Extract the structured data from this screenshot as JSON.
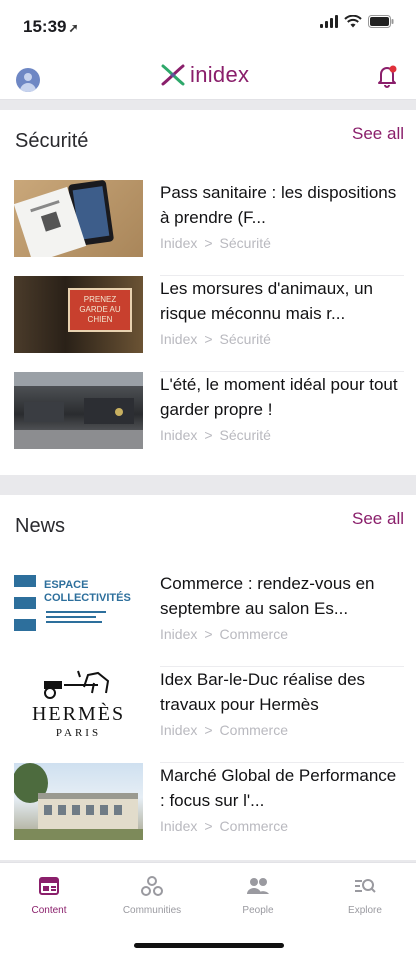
{
  "status_bar": {
    "time": "15:39"
  },
  "header": {
    "brand": "inidex"
  },
  "sections": [
    {
      "title": "Sécurité",
      "see_all": "See all",
      "items": [
        {
          "title": "Pass sanitaire : les dispositions à prendre (F...",
          "source": "Inidex",
          "sep": ">",
          "category": "Sécurité",
          "thumb_text": ""
        },
        {
          "title": "Les morsures d'animaux, un risque méconnu mais r...",
          "source": "Inidex",
          "sep": ">",
          "category": "Sécurité",
          "thumb_text": "PRENEZ GARDE AU CHIEN"
        },
        {
          "title": "L'été, le moment idéal pour tout garder propre !",
          "source": "Inidex",
          "sep": ">",
          "category": "Sécurité",
          "thumb_text": ""
        }
      ]
    },
    {
      "title": "News",
      "see_all": "See all",
      "items": [
        {
          "title": "Commerce : rendez-vous en septembre au salon Es...",
          "source": "Inidex",
          "sep": ">",
          "category": "Commerce",
          "thumb_text": "ESPACE COLLECTIVITÉS"
        },
        {
          "title": "Idex Bar-le-Duc réalise des travaux pour Hermès",
          "source": "Inidex",
          "sep": ">",
          "category": "Commerce",
          "thumb_text": "HERMÈS",
          "thumb_subtext": "PARIS"
        },
        {
          "title": "Marché Global de Performance : focus sur l'...",
          "source": "Inidex",
          "sep": ">",
          "category": "Commerce",
          "thumb_text": ""
        }
      ]
    }
  ],
  "tabs": [
    {
      "label": "Content",
      "icon": "content-icon",
      "active": true
    },
    {
      "label": "Communities",
      "icon": "communities-icon",
      "active": false
    },
    {
      "label": "People",
      "icon": "people-icon",
      "active": false
    },
    {
      "label": "Explore",
      "icon": "explore-icon",
      "active": false
    }
  ],
  "colors": {
    "accent": "#8a1f6b",
    "meta": "#b9b9bf",
    "background": "#e9e9ec"
  }
}
